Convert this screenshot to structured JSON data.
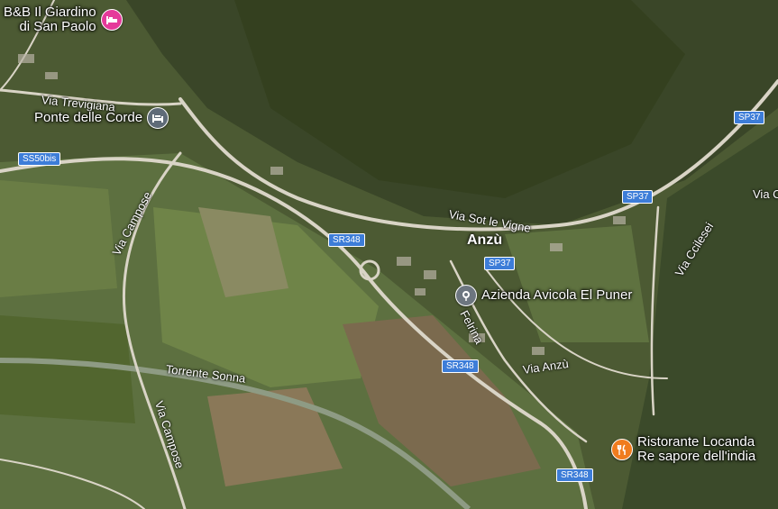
{
  "colors": {
    "hotel_pin": "#e5399a",
    "lodging_pin": "#5f6b78",
    "place_pin": "#6d7680",
    "restaurant_pin": "#f07c1e",
    "shield": "#3d7dd8"
  },
  "pois": [
    {
      "name_line1": "B&B Il Giardino",
      "name_line2": "di San Paolo",
      "icon": "hotel-bed-icon"
    },
    {
      "name_line1": "Ponte delle Corde",
      "name_line2": "",
      "icon": "lodging-icon"
    },
    {
      "name_line1": "Azienda Avicola El Puner",
      "name_line2": "",
      "icon": "place-pin-icon"
    },
    {
      "name_line1": "Ristorante Locanda",
      "name_line2": "Re sapore dell'india",
      "icon": "restaurant-fork-knife-icon"
    }
  ],
  "locality": "Anzù",
  "road_labels": [
    "Via Trevigiana",
    "Via Campose",
    "Via Sot le Vigne",
    "Via Ccilesei",
    "Felrina",
    "Via Anzù",
    "Torrente Sonna",
    "Via Campose",
    "Via C"
  ],
  "shields": [
    "SS50bis",
    "SR348",
    "SP37",
    "SP37",
    "SP37",
    "SR348",
    "SR348"
  ]
}
